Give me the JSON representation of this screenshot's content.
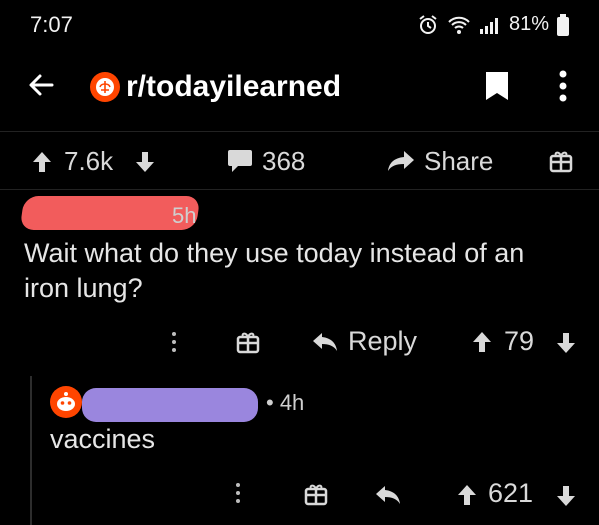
{
  "status_bar": {
    "time": "7:07",
    "battery": "81%",
    "icons": [
      "alarm-icon",
      "wifi-icon",
      "signal-icon",
      "battery-icon"
    ]
  },
  "header": {
    "subreddit": "r/todayilearned",
    "icons": [
      "back-arrow-icon",
      "subreddit-icon",
      "bookmark-icon",
      "more-vert-icon"
    ]
  },
  "post_actions": {
    "votes": "7.6k",
    "comments": "368",
    "share_label": "Share"
  },
  "comments": [
    {
      "time": "5h",
      "body": "Wait what do they use today instead of an iron lung?",
      "reply_label": "Reply",
      "votes": "79"
    },
    {
      "time": "• 4h",
      "body": "vaccines",
      "votes": "621"
    }
  ],
  "colors": {
    "background": "#000000",
    "accent": "#ff4500",
    "redact_1": "#f25c5c",
    "redact_2": "#9a86de"
  }
}
